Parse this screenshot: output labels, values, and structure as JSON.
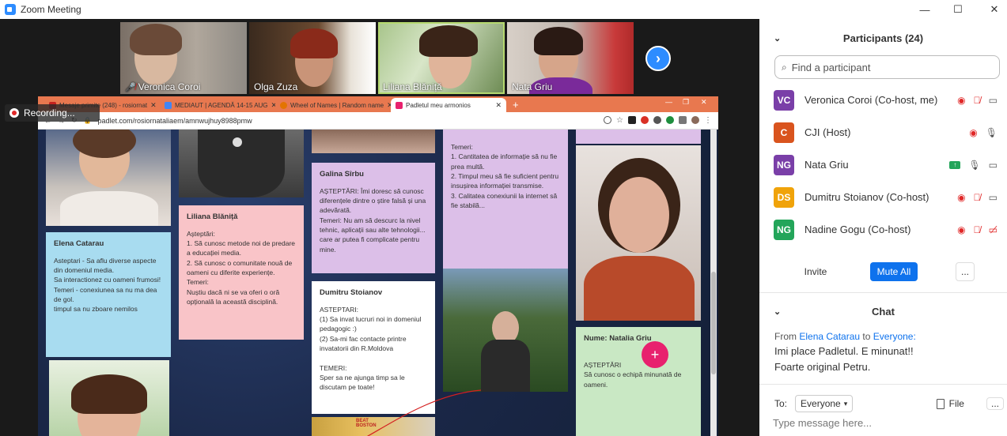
{
  "window": {
    "title": "Zoom Meeting"
  },
  "videos": [
    {
      "name": "Veronica Coroi",
      "muted": true
    },
    {
      "name": "Olga Zuza",
      "muted": false
    },
    {
      "name": "Liliana Blăniță",
      "muted": false
    },
    {
      "name": "Nata Griu",
      "muted": false
    }
  ],
  "recording": {
    "label": "Recording..."
  },
  "browser": {
    "tabs": [
      {
        "label": "Mesaje primite (248) - rosiornat",
        "color": "#c5221f"
      },
      {
        "label": "MEDIAUT | AGENDĂ 14-15 AUG",
        "color": "#4285f4"
      },
      {
        "label": "Wheel of Names | Random name",
        "color": "#e37400"
      },
      {
        "label": "Padletul meu armonios",
        "color": "#e8216e"
      }
    ],
    "new_tab": "+",
    "url": "padlet.com/rosiornataliaem/amnwujhuy8988pmw"
  },
  "padlet": {
    "cards": [
      {
        "title": "Elena Catarau",
        "body": "Asteptari - Sa aflu diverse aspecte din domeniul media.\nSa interactionez cu oameni frumosi!\nTemeri - conexiunea sa nu ma dea de gol.\ntimpul sa nu zboare nemilos"
      },
      {
        "title": "Liliana Blăniță",
        "body": "Așteptări:\n1. Să cunosc metode noi de predare a educației media.\n2. Să cunosc o comunitate nouă de oameni cu diferite experiențe.\nTemeri:\nNuștiu dacă ni se va oferi o  oră opțională la această disciplină."
      },
      {
        "title": "Galina Sîrbu",
        "body": "AȘTEPTĂRI: Îmi doresc să cunosc diferențele dintre o știre falsă și una adevărată.\nTemeri: Nu am să descurc la nivel tehnic, aplicații sau alte tehnologii... care ar putea fi complicate pentru mine."
      },
      {
        "title": "Dumitru Stoianov",
        "body": "ASTEPTARI:\n(1) Sa invat lucruri noi in domeniul pedagogic :)\n(2) Sa-mi fac contacte printre invatatorii din R.Moldova\n\nTEMERI:\nSper sa ne ajunga timp sa le discutam pe toate!"
      },
      {
        "title": "",
        "body": "Temeri:\n1. Cantitatea de informație să nu fie prea multă.\n2. Timpul meu să fie suficient pentru insușirea informației transmise.\n3. Calitatea conexiunii la internet să fie stabilă..."
      },
      {
        "title": "Nume: Natalia Griu",
        "body": "\nAȘTEPTĂRI\nSă cunosc o echipă minunată de oameni."
      }
    ],
    "fab": "+"
  },
  "participants": {
    "header": "Participants (24)",
    "search_placeholder": "Find a participant",
    "list": [
      {
        "initials": "VC",
        "name": "Veronica Coroi (Co-host, me)",
        "color": "#7a3fa8"
      },
      {
        "initials": "C",
        "name": "CJI (Host)",
        "color": "#d9541e"
      },
      {
        "initials": "NG",
        "name": "Nata Griu",
        "color": "#7a3fa8"
      },
      {
        "initials": "DS",
        "name": "Dumitru Stoianov (Co-host)",
        "color": "#f0a30a"
      },
      {
        "initials": "NG",
        "name": "Nadine Gogu (Co-host)",
        "color": "#23a55a"
      }
    ],
    "invite": "Invite",
    "mute_all": "Mute All",
    "more": "..."
  },
  "chat": {
    "header": "Chat",
    "from_prefix": "From",
    "sender": "Elena Catarau",
    "to_word": "to",
    "recipient": "Everyone:",
    "message_line1": "Imi place Padletul. E minunat!!",
    "message_line2": "Foarte original Petru.",
    "to_label": "To:",
    "to_value": "Everyone",
    "file_label": "File",
    "more": "...",
    "input_placeholder": "Type message here..."
  },
  "colors": {
    "zoom_blue": "#2d8cff",
    "card_blue": "#a8dcf0",
    "card_pink": "#f9c4c8",
    "card_purple": "#dcbfe8",
    "card_green": "#c9e8c4",
    "padlet_tabstrip": "#e8784f",
    "mute_red": "#e02828"
  }
}
